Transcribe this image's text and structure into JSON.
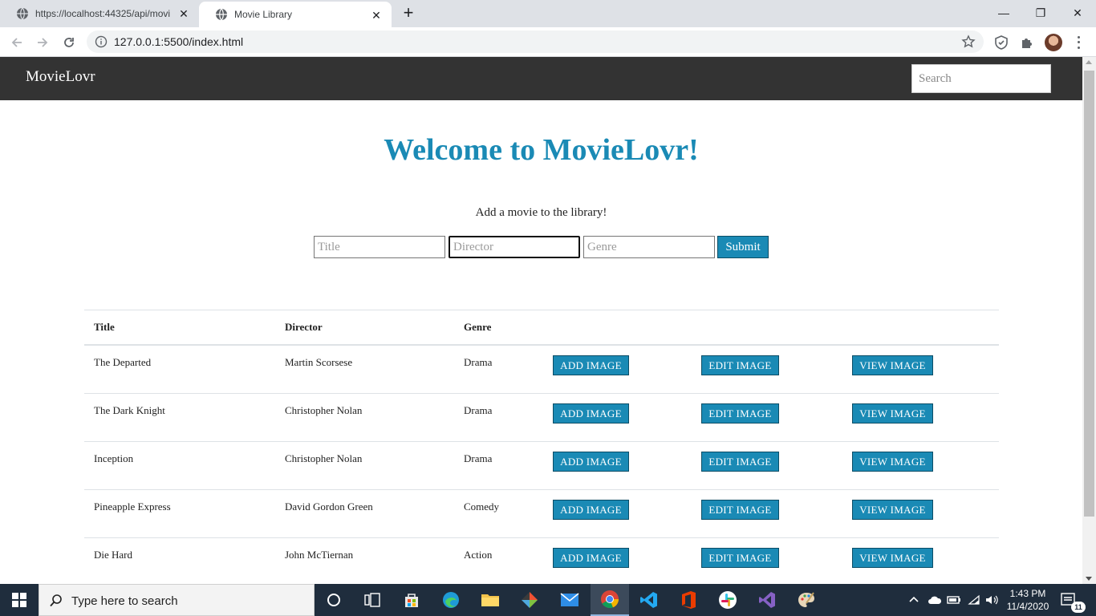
{
  "browser": {
    "tabs": [
      {
        "title": "https://localhost:44325/api/movi",
        "active": false
      },
      {
        "title": "Movie Library",
        "active": true
      }
    ],
    "new_tab_symbol": "+",
    "url": "127.0.0.1:5500/index.html",
    "window_controls": {
      "minimize": "—",
      "restore": "❐",
      "close": "✕"
    }
  },
  "site": {
    "brand": "MovieLovr",
    "search_placeholder": "Search",
    "heading": "Welcome to MovieLovr!",
    "add_caption": "Add a movie to the library!",
    "form": {
      "title_placeholder": "Title",
      "director_placeholder": "Director",
      "genre_placeholder": "Genre",
      "submit_label": "Submit"
    },
    "table": {
      "headers": {
        "title": "Title",
        "director": "Director",
        "genre": "Genre"
      },
      "rows": [
        {
          "title": "The Departed",
          "director": "Martin Scorsese",
          "genre": "Drama"
        },
        {
          "title": "The Dark Knight",
          "director": "Christopher Nolan",
          "genre": "Drama"
        },
        {
          "title": "Inception",
          "director": "Christopher Nolan",
          "genre": "Drama"
        },
        {
          "title": "Pineapple Express",
          "director": "David Gordon Green",
          "genre": "Comedy"
        },
        {
          "title": "Die Hard",
          "director": "John McTiernan",
          "genre": "Action"
        }
      ],
      "buttons": {
        "add": "ADD IMAGE",
        "edit": "EDIT IMAGE",
        "view": "VIEW IMAGE"
      }
    },
    "colors": {
      "accent": "#1a8ab5",
      "navbar": "#333333"
    }
  },
  "taskbar": {
    "search_placeholder": "Type here to search",
    "time": "1:43 PM",
    "date": "11/4/2020",
    "notification_count": "11"
  }
}
